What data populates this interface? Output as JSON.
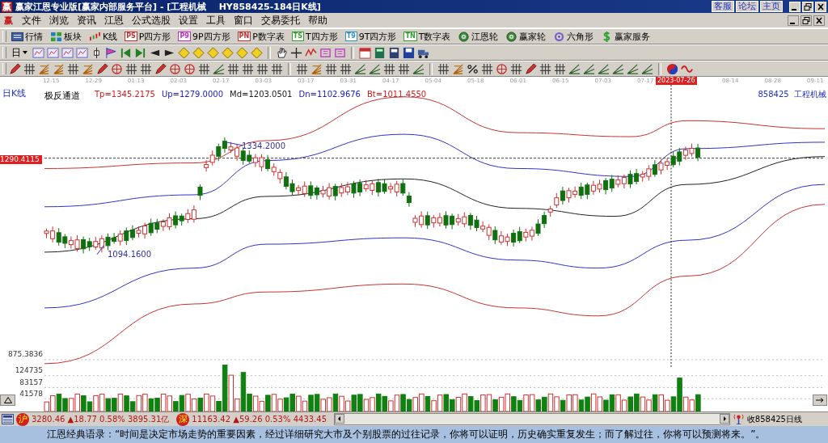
{
  "window": {
    "logo": "赢",
    "title": "赢家江恩专业版[赢家内部服务平台] - [工程机械    HY858425-184日K线]",
    "links": [
      "客服",
      "论坛",
      "主页"
    ]
  },
  "menu_logo": "赢",
  "menu": [
    "文件",
    "浏览",
    "资讯",
    "江恩",
    "公式选股",
    "设置",
    "工具",
    "窗口",
    "交易委托",
    "帮助"
  ],
  "toolbar": [
    {
      "label": "行情",
      "kind": "screen"
    },
    {
      "label": "板块",
      "kind": "blocks"
    },
    {
      "label": "K线",
      "kind": "candles"
    },
    {
      "label": "P四方形",
      "kind": "tag",
      "tag": "PS",
      "color": "#c03030"
    },
    {
      "label": "9P四方形",
      "kind": "tag",
      "tag": "P9",
      "color": "#c030c0"
    },
    {
      "label": "P数字表",
      "kind": "tag",
      "tag": "PN",
      "color": "#c03030"
    },
    {
      "label": "T四方形",
      "kind": "tag",
      "tag": "TS",
      "color": "#30a030"
    },
    {
      "label": "9T四方形",
      "kind": "tag",
      "tag": "T9",
      "color": "#3090c0"
    },
    {
      "label": "T数字表",
      "kind": "tag",
      "tag": "TN",
      "color": "#30a030"
    },
    {
      "label": "江恩轮",
      "kind": "wheel"
    },
    {
      "label": "赢家轮",
      "kind": "wheel"
    },
    {
      "label": "六角形",
      "kind": "hexagon"
    },
    {
      "label": "赢家服务",
      "kind": "dollar"
    }
  ],
  "period": {
    "label": "日"
  },
  "dates": [
    {
      "label": "12-15",
      "selected": false
    },
    {
      "label": "12-29",
      "selected": false
    },
    {
      "label": "01-13",
      "selected": false
    },
    {
      "label": "02-03",
      "selected": false
    },
    {
      "label": "02-17",
      "selected": false
    },
    {
      "label": "03-03",
      "selected": false
    },
    {
      "label": "03-17",
      "selected": false
    },
    {
      "label": "03-31",
      "selected": false
    },
    {
      "label": "04-17",
      "selected": false
    },
    {
      "label": "05-04",
      "selected": false
    },
    {
      "label": "05-18",
      "selected": false
    },
    {
      "label": "06-01",
      "selected": false
    },
    {
      "label": "06-15",
      "selected": false
    },
    {
      "label": "07-03",
      "selected": false
    },
    {
      "label": "07-17",
      "selected": false
    },
    {
      "label": "2023-07-26",
      "selected": true
    },
    {
      "label": "08-14",
      "selected": false
    },
    {
      "label": "08-28",
      "selected": false
    },
    {
      "label": "09-11",
      "selected": false
    }
  ],
  "chart": {
    "period_label": "日K线",
    "indicator": "极反通道",
    "legend": [
      {
        "text": "Tp=1345.2175",
        "color": "#d02020"
      },
      {
        "text": "Up=1279.0000",
        "color": "#2020c0"
      },
      {
        "text": "Md=1203.0501",
        "color": "#202020"
      },
      {
        "text": "Dn=1102.9676",
        "color": "#2020c0"
      },
      {
        "text": "Bt=1011.4550",
        "color": "#d02020"
      }
    ],
    "symbol": "858425  工程机械",
    "price_label": "1290.4115",
    "high_label": "1334.2000",
    "low_label": "1094.1600",
    "volume_labels": [
      "875.3836",
      "124735",
      "83157",
      "41578"
    ]
  },
  "status": {
    "indices": [
      {
        "badge": "沪",
        "text": "3280.46 ▲18.77 0.58% 3895.31亿"
      },
      {
        "badge": "深",
        "text": "11163.42 ▲59.26 0.53% 4433.45"
      }
    ],
    "receive": "收858425日线"
  },
  "ticker": "江恩经典语录：“时间是决定市场走势的重要因素，经过详细研究大市及个别股票的过往记录，你将可以证明，历史确实重复发生；而了解过往，你将可以预测将来。”。"
}
